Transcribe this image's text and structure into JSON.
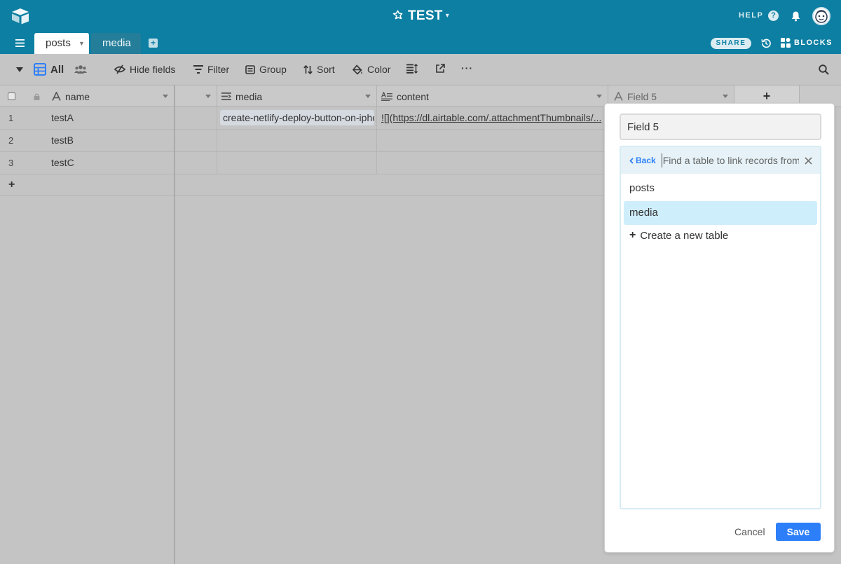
{
  "header": {
    "base_name": "TEST",
    "help_label": "HELP",
    "help_icon_glyph": "?",
    "share_label": "SHARE",
    "blocks_label": "BLOCKS",
    "brand_color": "#0d7fa2"
  },
  "tabs": [
    {
      "label": "posts",
      "active": true
    },
    {
      "label": "media",
      "active": false
    }
  ],
  "toolbar": {
    "view_name": "All",
    "hide_fields": "Hide fields",
    "filter": "Filter",
    "group": "Group",
    "sort": "Sort",
    "color": "Color",
    "more": "···"
  },
  "grid": {
    "columns": [
      {
        "name": "name",
        "icon": "text-icon"
      },
      {
        "name": "",
        "icon": ""
      },
      {
        "name": "media",
        "icon": "link-icon"
      },
      {
        "name": "content",
        "icon": "long-text-icon"
      },
      {
        "name": "Field 5",
        "icon": "text-icon"
      }
    ],
    "add_column": "+",
    "rows": [
      {
        "num": "1",
        "name": "testA",
        "media": "create-netlify-deploy-button-on-iphone",
        "content": "![](https://dl.airtable.com/.attachmentThumbnails/..."
      },
      {
        "num": "2",
        "name": "testB",
        "media": "",
        "content": ""
      },
      {
        "num": "3",
        "name": "testC",
        "media": "",
        "content": ""
      }
    ],
    "add_row": "+"
  },
  "field_editor": {
    "field_name": "Field 5",
    "back_label": "Back",
    "find_placeholder": "Find a table to link records from",
    "tables": [
      "posts",
      "media"
    ],
    "selected_table": "media",
    "create_table_label": "Create a new table",
    "cancel_label": "Cancel",
    "save_label": "Save",
    "accent_color": "#2d7ff9"
  }
}
